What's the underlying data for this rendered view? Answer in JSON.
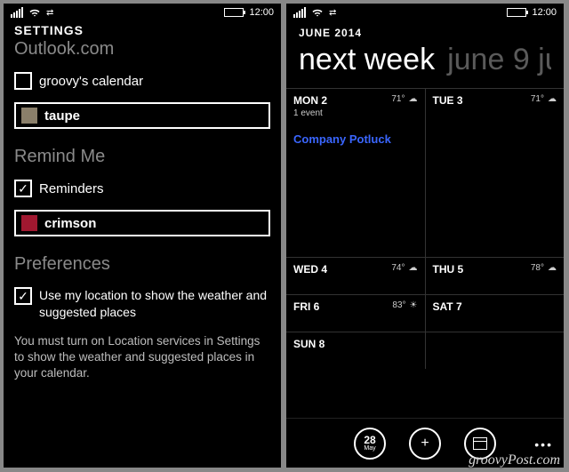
{
  "status": {
    "time": "12:00"
  },
  "settings": {
    "title": "SETTINGS",
    "account": "Outlook.com",
    "cal_checkbox_label": "groovy's calendar",
    "cal_color_name": "taupe",
    "cal_color_hex": "#8a7f6a",
    "remind_header": "Remind Me",
    "reminders_label": "Reminders",
    "rem_color_name": "crimson",
    "rem_color_hex": "#a01830",
    "pref_header": "Preferences",
    "pref_checkbox_label": "Use my location to show the weather and suggested places",
    "pref_note": "You must turn on Location services in Settings to show the weather and suggested places in your calendar."
  },
  "calendar": {
    "month": "JUNE 2014",
    "title_main": "next week",
    "title_dim": "june 9 ju",
    "days": {
      "mon": {
        "label": "MON 2",
        "sub": "1 event",
        "temp": "71°",
        "event": "Company Potluck"
      },
      "tue": {
        "label": "TUE 3",
        "temp": "71°"
      },
      "wed": {
        "label": "WED 4",
        "temp": "74°"
      },
      "thu": {
        "label": "THU 5",
        "temp": "78°"
      },
      "fri": {
        "label": "FRI 6",
        "temp": "83°"
      },
      "sat": {
        "label": "SAT 7"
      },
      "sun": {
        "label": "SUN 8"
      }
    },
    "appbar": {
      "today_num": "28",
      "today_mon": "May"
    }
  },
  "watermark": "groovyPost.com"
}
